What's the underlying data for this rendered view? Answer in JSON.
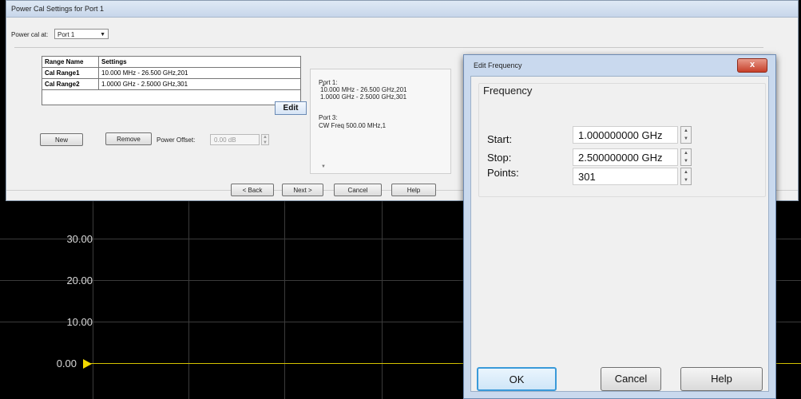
{
  "main_dialog": {
    "title": "Power Cal Settings for Port 1",
    "power_cal_label": "Power cal at:",
    "power_cal_value": "Port 1",
    "table": {
      "headers": [
        "Range Name",
        "Settings"
      ],
      "rows": [
        {
          "name": "Cal Range1",
          "settings": "10.000 MHz -  26.500 GHz,201"
        },
        {
          "name": "Cal Range2",
          "settings": "1.0000 GHz -  2.5000 GHz,301"
        }
      ]
    },
    "edit_label": "Edit",
    "new_label": "New",
    "remove_label": "Remove",
    "power_offset_label": "Power Offset:",
    "power_offset_value": "0.00 dB",
    "summary_lines": [
      "Port 1:",
      "10.000 MHz -  26.500 GHz,201",
      "1.0000 GHz -  2.5000 GHz,301",
      "Port 3:",
      "CW Freq  500.00 MHz,1"
    ],
    "back_label": "< Back",
    "next_label": "Next >",
    "cancel_label": "Cancel",
    "help_label": "Help"
  },
  "edit_dialog": {
    "title": "Edit Frequency",
    "close_label": "x",
    "group_label": "Frequency",
    "start_label": "Start:",
    "start_value": "1.000000000 GHz",
    "stop_label": "Stop:",
    "stop_value": "2.500000000 GHz",
    "points_label": "Points:",
    "points_value": "301",
    "ok_label": "OK",
    "cancel_label": "Cancel",
    "help_label": "Help"
  },
  "graph": {
    "y_labels": [
      "30.00",
      "20.00",
      "10.00",
      "0.00"
    ],
    "trace_color": "#d4c200",
    "marker_color": "#f2d800"
  }
}
